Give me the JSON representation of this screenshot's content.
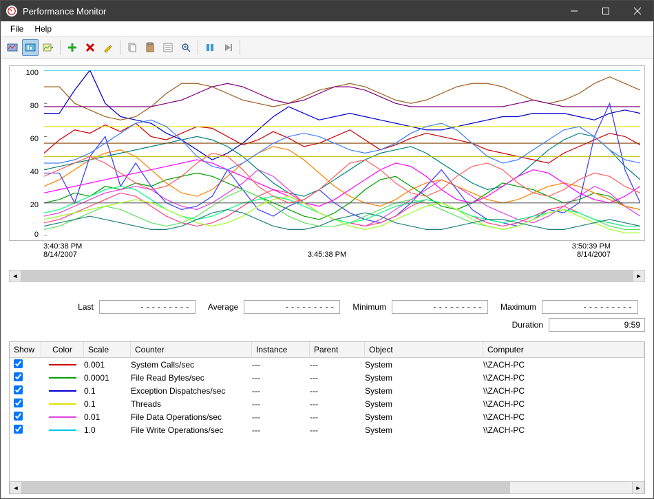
{
  "window": {
    "title": "Performance Monitor"
  },
  "menu": {
    "file": "File",
    "help": "Help"
  },
  "chart_data": {
    "type": "line",
    "title": "",
    "xlabel": "",
    "ylabel": "",
    "ylim": [
      0,
      100
    ],
    "yticks": [
      0,
      20,
      40,
      60,
      80,
      100
    ],
    "x_time_labels": {
      "start_time": "3:40:38 PM",
      "start_date": "8/14/2007",
      "mid_time": "3:45:38 PM",
      "end_time": "3:50:39 PM",
      "end_date": "8/14/2007"
    },
    "note": "many_overlapping_counter_lines_values_approximate",
    "series": [
      {
        "name": "SystemCalls",
        "color": "#cc0000",
        "values": [
          50,
          58,
          64,
          62,
          67,
          63,
          68,
          60,
          58,
          62,
          66,
          65,
          60,
          55,
          58,
          63,
          59,
          54,
          56,
          60,
          64,
          58,
          52,
          55,
          59,
          62,
          60,
          58,
          56,
          52,
          50,
          48,
          46,
          44,
          50,
          54,
          58,
          62,
          60,
          55
        ]
      },
      {
        "name": "FileReadBytes",
        "color": "#00a000",
        "values": [
          20,
          22,
          26,
          24,
          30,
          28,
          32,
          30,
          34,
          36,
          38,
          36,
          32,
          28,
          24,
          20,
          16,
          12,
          10,
          14,
          20,
          28,
          34,
          36,
          30,
          24,
          18,
          16,
          20,
          26,
          32,
          30,
          28,
          24,
          20,
          22,
          26,
          24,
          18,
          16
        ]
      },
      {
        "name": "ExceptionDispatches",
        "color": "#0000d0",
        "values": [
          74,
          74,
          88,
          100,
          80,
          72,
          70,
          68,
          62,
          58,
          52,
          46,
          50,
          56,
          64,
          72,
          78,
          74,
          70,
          72,
          74,
          72,
          70,
          68,
          66,
          64,
          64,
          66,
          68,
          70,
          72,
          72,
          74,
          74,
          74,
          72,
          70,
          74,
          76,
          74
        ]
      },
      {
        "name": "Threads",
        "color": "#e2e200",
        "values": [
          66,
          66,
          66,
          66,
          66,
          66,
          66,
          66,
          66,
          66,
          66,
          66,
          66,
          66,
          66,
          66,
          66,
          66,
          66,
          66,
          66,
          66,
          66,
          66,
          66,
          66,
          66,
          66,
          66,
          66,
          66,
          66,
          66,
          66,
          66,
          66,
          66,
          66,
          66,
          66
        ]
      },
      {
        "name": "FileDataOps",
        "color": "#e040e0",
        "values": [
          12,
          14,
          18,
          22,
          26,
          28,
          30,
          28,
          22,
          18,
          16,
          20,
          26,
          32,
          40,
          36,
          28,
          20,
          14,
          10,
          8,
          6,
          10,
          16,
          22,
          28,
          34,
          30,
          24,
          18,
          14,
          10,
          8,
          12,
          18,
          24,
          30,
          26,
          18,
          12
        ]
      },
      {
        "name": "FileWriteOps",
        "color": "#00c8e8",
        "values": [
          100,
          100,
          100,
          100,
          100,
          100,
          100,
          100,
          100,
          100,
          100,
          100,
          100,
          100,
          100,
          100,
          100,
          100,
          100,
          100,
          100,
          100,
          100,
          100,
          100,
          100,
          100,
          100,
          100,
          100,
          100,
          100,
          100,
          100,
          100,
          100,
          100,
          100,
          100,
          100
        ]
      },
      {
        "name": "s7",
        "color": "#a06020",
        "values": [
          90,
          90,
          80,
          76,
          72,
          70,
          72,
          78,
          86,
          92,
          92,
          90,
          86,
          82,
          80,
          78,
          80,
          84,
          88,
          90,
          92,
          90,
          86,
          82,
          80,
          82,
          86,
          90,
          92,
          92,
          90,
          86,
          82,
          80,
          82,
          86,
          92,
          96,
          92,
          88
        ]
      },
      {
        "name": "s8",
        "color": "#800080",
        "values": [
          78,
          78,
          78,
          78,
          78,
          78,
          78,
          78,
          80,
          82,
          86,
          90,
          92,
          90,
          86,
          82,
          80,
          82,
          86,
          90,
          90,
          88,
          84,
          80,
          78,
          78,
          78,
          78,
          78,
          78,
          78,
          80,
          82,
          80,
          78,
          78,
          78,
          78,
          78,
          78
        ]
      },
      {
        "name": "s9",
        "color": "#008080",
        "values": [
          40,
          42,
          44,
          46,
          48,
          50,
          52,
          54,
          56,
          58,
          60,
          58,
          54,
          48,
          40,
          32,
          26,
          24,
          28,
          34,
          40,
          46,
          50,
          52,
          54,
          50,
          44,
          38,
          32,
          28,
          30,
          36,
          44,
          52,
          58,
          62,
          60,
          52,
          42,
          34
        ]
      },
      {
        "name": "s10",
        "color": "#ff8000",
        "values": [
          30,
          34,
          40,
          46,
          50,
          52,
          48,
          40,
          32,
          26,
          24,
          28,
          36,
          44,
          50,
          54,
          52,
          46,
          38,
          30,
          24,
          20,
          18,
          22,
          28,
          32,
          34,
          30,
          26,
          22,
          20,
          22,
          26,
          30,
          32,
          30,
          26,
          22,
          18,
          16
        ]
      },
      {
        "name": "s11",
        "color": "#804000",
        "values": [
          56,
          56,
          56,
          56,
          56,
          56,
          56,
          56,
          56,
          56,
          56,
          56,
          56,
          56,
          56,
          56,
          56,
          56,
          56,
          56,
          56,
          56,
          56,
          56,
          56,
          56,
          56,
          56,
          56,
          56,
          56,
          56,
          56,
          56,
          56,
          56,
          56,
          56,
          56,
          56
        ]
      },
      {
        "name": "s12",
        "color": "#4040ff",
        "values": [
          38,
          38,
          20,
          48,
          60,
          30,
          44,
          30,
          20,
          16,
          18,
          24,
          40,
          28,
          16,
          12,
          18,
          22,
          28,
          20,
          14,
          10,
          8,
          12,
          20,
          30,
          40,
          28,
          16,
          10,
          8,
          6,
          10,
          16,
          14,
          20,
          60,
          80,
          40,
          20
        ]
      },
      {
        "name": "s13",
        "color": "#ff4080",
        "values": [
          8,
          10,
          14,
          18,
          22,
          26,
          24,
          18,
          12,
          8,
          6,
          8,
          12,
          18,
          24,
          28,
          26,
          20,
          14,
          10,
          8,
          6,
          8,
          12,
          18,
          22,
          20,
          16,
          12,
          8,
          6,
          8,
          12,
          16,
          18,
          14,
          10,
          8,
          6,
          6
        ]
      },
      {
        "name": "s14",
        "color": "#60e060",
        "values": [
          4,
          6,
          10,
          14,
          18,
          16,
          12,
          8,
          6,
          8,
          12,
          18,
          24,
          28,
          24,
          18,
          12,
          8,
          6,
          6,
          8,
          12,
          16,
          20,
          22,
          20,
          16,
          12,
          8,
          6,
          4,
          6,
          10,
          14,
          16,
          14,
          10,
          6,
          4,
          4
        ]
      },
      {
        "name": "s15",
        "color": "#c0c000",
        "values": [
          48,
          48,
          48,
          48,
          48,
          48,
          48,
          48,
          48,
          48,
          48,
          48,
          48,
          48,
          48,
          48,
          48,
          48,
          48,
          48,
          48,
          48,
          48,
          48,
          48,
          48,
          48,
          48,
          48,
          48,
          48,
          48,
          48,
          48,
          48,
          48,
          48,
          48,
          48,
          48
        ]
      },
      {
        "name": "s16",
        "color": "#ff00ff",
        "values": [
          26,
          28,
          30,
          32,
          34,
          36,
          38,
          40,
          42,
          44,
          46,
          44,
          40,
          36,
          32,
          28,
          24,
          20,
          18,
          22,
          28,
          34,
          40,
          44,
          42,
          36,
          28,
          22,
          20,
          24,
          30,
          36,
          40,
          38,
          32,
          26,
          22,
          20,
          24,
          30
        ]
      },
      {
        "name": "s17",
        "color": "#00ff80",
        "values": [
          14,
          16,
          20,
          24,
          28,
          30,
          28,
          22,
          16,
          12,
          10,
          12,
          16,
          20,
          22,
          24,
          22,
          18,
          14,
          10,
          8,
          10,
          14,
          18,
          20,
          22,
          20,
          16,
          12,
          10,
          8,
          10,
          12,
          14,
          16,
          14,
          10,
          8,
          6,
          6
        ]
      },
      {
        "name": "s18",
        "color": "#606060",
        "values": [
          20,
          20,
          20,
          20,
          20,
          20,
          20,
          20,
          20,
          20,
          20,
          20,
          20,
          20,
          20,
          20,
          20,
          20,
          20,
          20,
          20,
          20,
          20,
          20,
          20,
          20,
          20,
          20,
          20,
          20,
          20,
          20,
          20,
          20,
          20,
          20,
          20,
          20,
          20,
          20
        ]
      },
      {
        "name": "s19",
        "color": "#4080ff",
        "values": [
          44,
          44,
          46,
          50,
          56,
          62,
          68,
          70,
          66,
          58,
          48,
          42,
          40,
          44,
          50,
          56,
          60,
          62,
          60,
          56,
          52,
          50,
          52,
          56,
          62,
          66,
          68,
          64,
          56,
          48,
          44,
          46,
          52,
          58,
          64,
          66,
          60,
          52,
          46,
          44
        ]
      },
      {
        "name": "s20",
        "color": "#a0ff20",
        "values": [
          10,
          12,
          14,
          16,
          18,
          20,
          22,
          20,
          16,
          12,
          8,
          6,
          8,
          12,
          18,
          22,
          24,
          20,
          14,
          10,
          6,
          4,
          6,
          10,
          14,
          18,
          20,
          16,
          10,
          6,
          4,
          6,
          10,
          14,
          16,
          12,
          8,
          4,
          2,
          2
        ]
      },
      {
        "name": "s21",
        "color": "#ff6060",
        "values": [
          36,
          40,
          44,
          48,
          44,
          38,
          32,
          28,
          30,
          36,
          44,
          50,
          48,
          40,
          30,
          24,
          20,
          22,
          28,
          36,
          44,
          46,
          40,
          32,
          26,
          24,
          28,
          36,
          42,
          44,
          40,
          32,
          26,
          24,
          28,
          34,
          38,
          36,
          30,
          26
        ]
      },
      {
        "name": "s22",
        "color": "#208080",
        "values": [
          6,
          8,
          10,
          12,
          10,
          8,
          6,
          4,
          4,
          6,
          10,
          14,
          16,
          14,
          10,
          6,
          4,
          4,
          6,
          10,
          12,
          14,
          12,
          8,
          6,
          4,
          4,
          6,
          8,
          10,
          10,
          8,
          6,
          4,
          4,
          6,
          8,
          10,
          8,
          6
        ]
      }
    ]
  },
  "stats": {
    "last_label": "Last",
    "last_value": "---------",
    "avg_label": "Average",
    "avg_value": "---------",
    "min_label": "Minimum",
    "min_value": "---------",
    "max_label": "Maximum",
    "max_value": "---------",
    "dur_label": "Duration",
    "dur_value": "9:59"
  },
  "grid": {
    "headers": {
      "show": "Show",
      "color": "Color",
      "scale": "Scale",
      "counter": "Counter",
      "instance": "Instance",
      "parent": "Parent",
      "object": "Object",
      "computer": "Computer"
    },
    "rows": [
      {
        "color": "#cc0000",
        "scale": "0.001",
        "counter": "System Calls/sec",
        "instance": "---",
        "parent": "---",
        "object": "System",
        "computer": "\\\\ZACH-PC"
      },
      {
        "color": "#00a000",
        "scale": "0.0001",
        "counter": "File Read Bytes/sec",
        "instance": "---",
        "parent": "---",
        "object": "System",
        "computer": "\\\\ZACH-PC"
      },
      {
        "color": "#0000d0",
        "scale": "0.1",
        "counter": "Exception Dispatches/sec",
        "instance": "---",
        "parent": "---",
        "object": "System",
        "computer": "\\\\ZACH-PC"
      },
      {
        "color": "#e2e200",
        "scale": "0.1",
        "counter": "Threads",
        "instance": "---",
        "parent": "---",
        "object": "System",
        "computer": "\\\\ZACH-PC"
      },
      {
        "color": "#e040e0",
        "scale": "0.01",
        "counter": "File Data Operations/sec",
        "instance": "---",
        "parent": "---",
        "object": "System",
        "computer": "\\\\ZACH-PC"
      },
      {
        "color": "#00c8e8",
        "scale": "1.0",
        "counter": "File Write Operations/sec",
        "instance": "---",
        "parent": "---",
        "object": "System",
        "computer": "\\\\ZACH-PC"
      }
    ]
  }
}
